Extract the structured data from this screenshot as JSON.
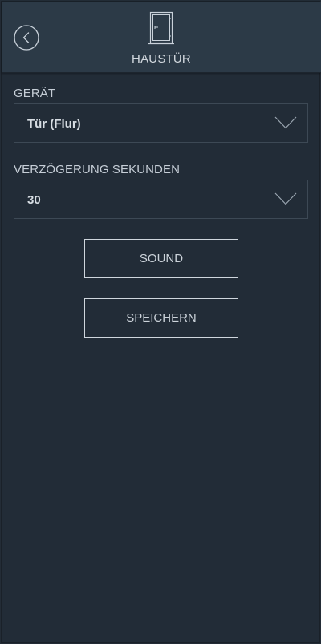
{
  "header": {
    "title": "HAUSTÜR",
    "back_icon": "chevron-left-circle-icon",
    "title_icon": "door-icon"
  },
  "form": {
    "device": {
      "label": "GERÄT",
      "value": "Tür (Flur)"
    },
    "delay": {
      "label": "VERZÖGERUNG SEKUNDEN",
      "value": "30"
    }
  },
  "buttons": {
    "sound_label": "SOUND",
    "save_label": "SPEICHERN"
  },
  "colors": {
    "background": "#222c37",
    "header_background": "#2c3a47",
    "text": "#c9d1da",
    "border": "#3d4955",
    "button_border": "#cfd6dd"
  }
}
